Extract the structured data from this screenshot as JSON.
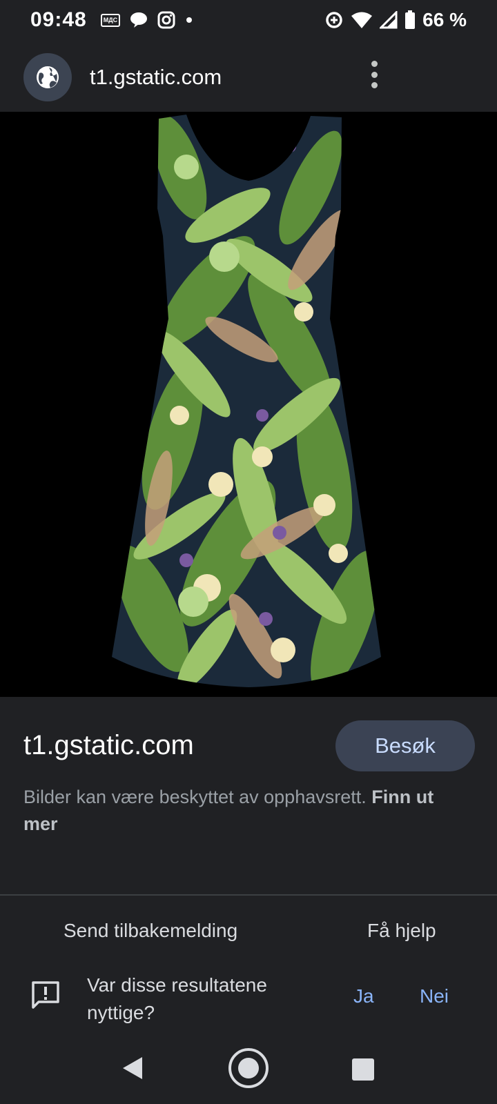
{
  "status_bar": {
    "time": "09:48",
    "mds_label": "MДС",
    "battery_text": "66 %",
    "icons": [
      "mds-icon",
      "chat-icon",
      "instagram-icon",
      "dot-icon",
      "data-saver-icon",
      "wifi-icon",
      "signal-icon",
      "battery-icon"
    ]
  },
  "header": {
    "url": "t1.gstatic.com",
    "icons": [
      "globe-icon",
      "more-vert-icon"
    ]
  },
  "image": {
    "background": "#000000",
    "palette": [
      "#1b2a3a",
      "#5e8f3a",
      "#9cc46a",
      "#c4a07a",
      "#f1e6b8",
      "#7a5aa0"
    ]
  },
  "info": {
    "domain": "t1.gstatic.com",
    "visit_label": "Besøk",
    "copyright_text": "Bilder kan være beskyttet av opphavsrett.",
    "learn_more": "Finn ut mer"
  },
  "footer": {
    "send_feedback": "Send tilbakemelding",
    "get_help": "Få hjelp",
    "question": "Var disse resultatene nyttige?",
    "yes": "Ja",
    "no": "Nei"
  },
  "colors": {
    "background": "#202124",
    "accent": "#8ab4f8",
    "button_bg": "#3b4354"
  }
}
